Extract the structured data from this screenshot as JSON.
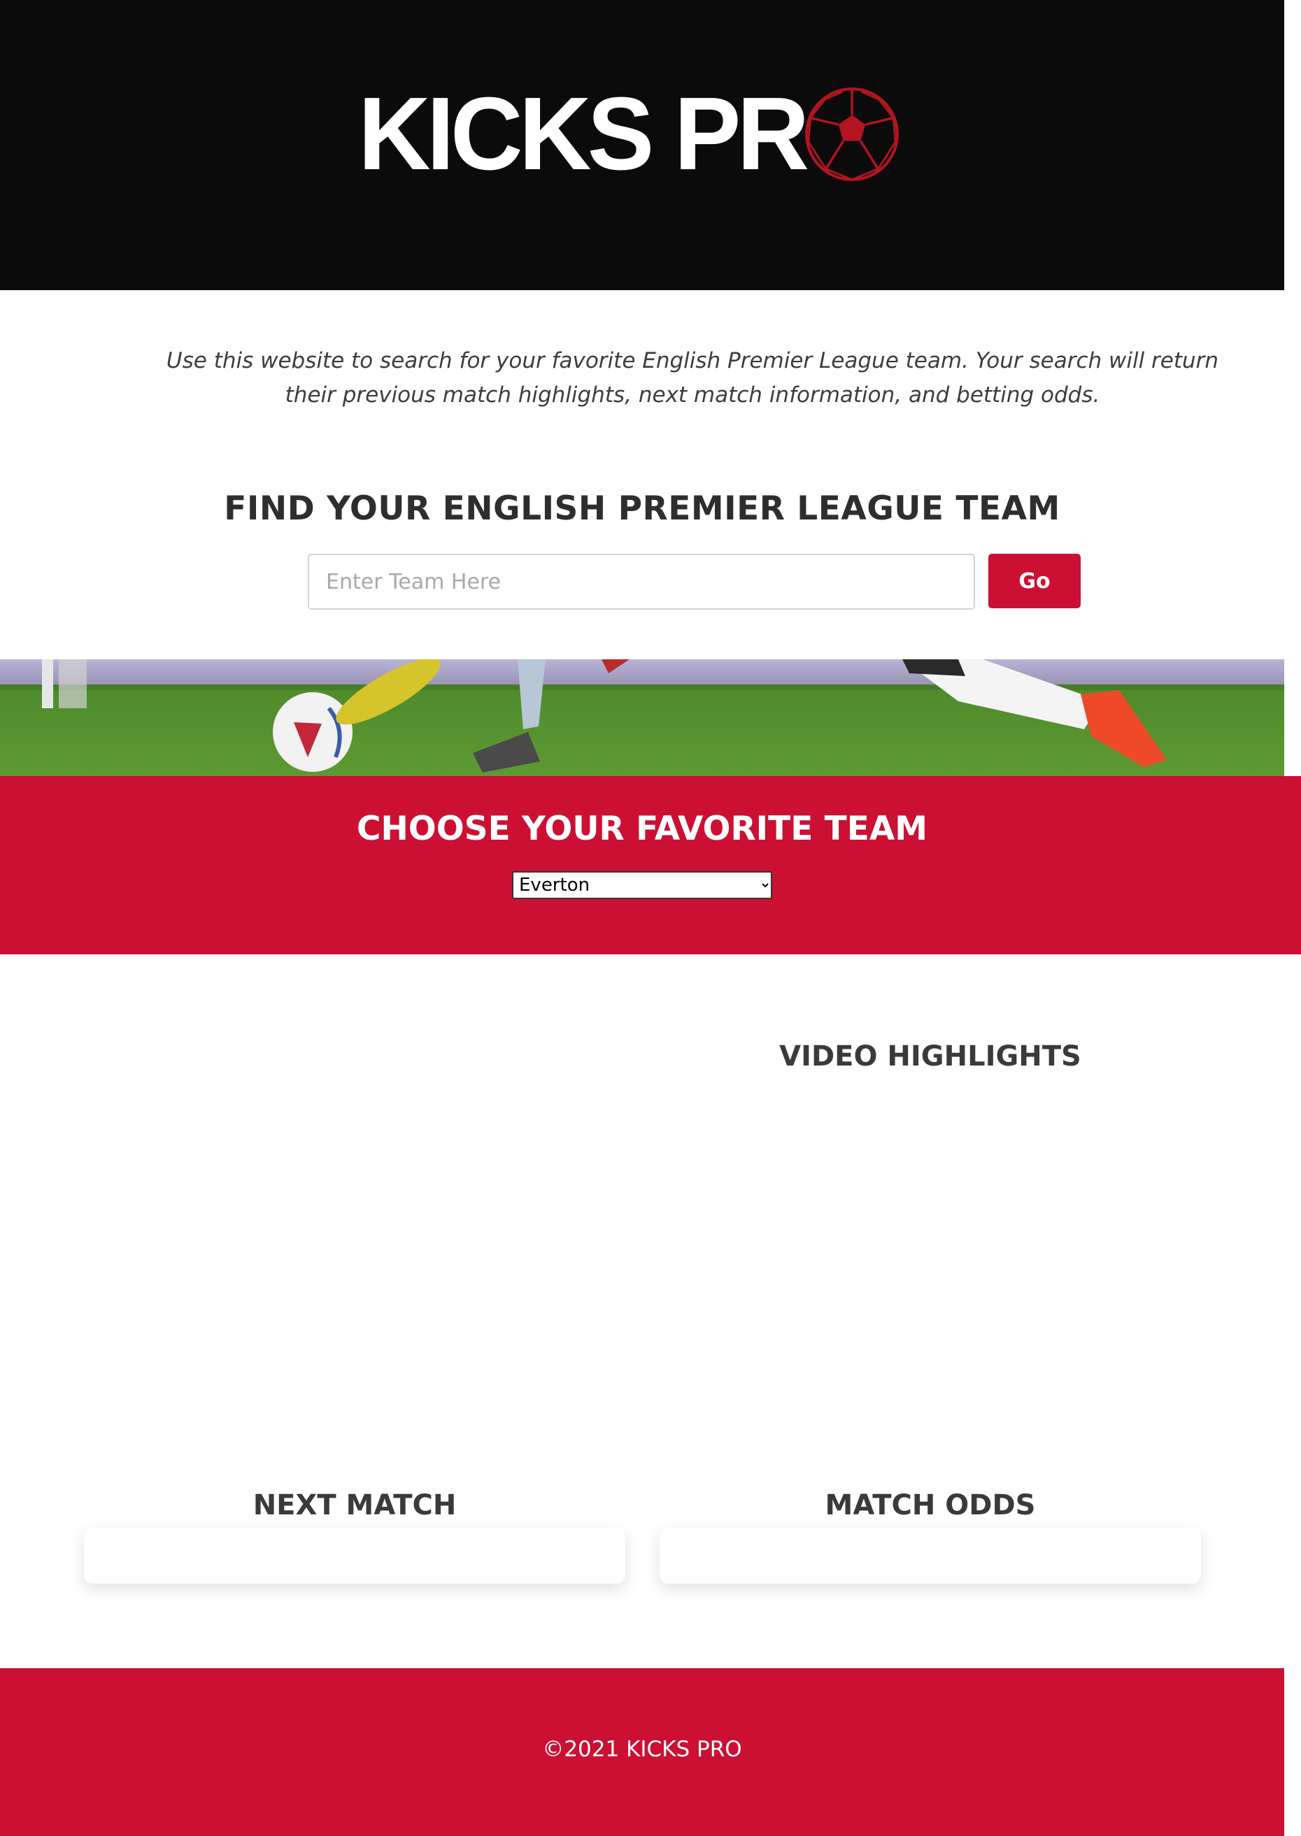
{
  "brand": {
    "logo_text": "KICKS PR",
    "logo_ball_icon": "soccer-ball-icon",
    "accent_color": "#cc1033",
    "header_color": "#0b0b0c"
  },
  "intro": {
    "text": "Use this website to search for your favorite English Premier League team. Your search will return their previous match highlights, next match information, and betting odds."
  },
  "search": {
    "title": "FIND YOUR ENGLISH PREMIER LEAGUE TEAM",
    "placeholder": "Enter Team Here",
    "value": "",
    "button_label": "Go"
  },
  "choose": {
    "title": "CHOOSE YOUR FAVORITE TEAM",
    "selected_team": "Everton"
  },
  "sections": {
    "video_title": "VIDEO HIGHLIGHTS",
    "next_match_title": "NEXT MATCH",
    "odds_title": "MATCH ODDS"
  },
  "footer": {
    "text": "©2021 KICKS PRO"
  }
}
